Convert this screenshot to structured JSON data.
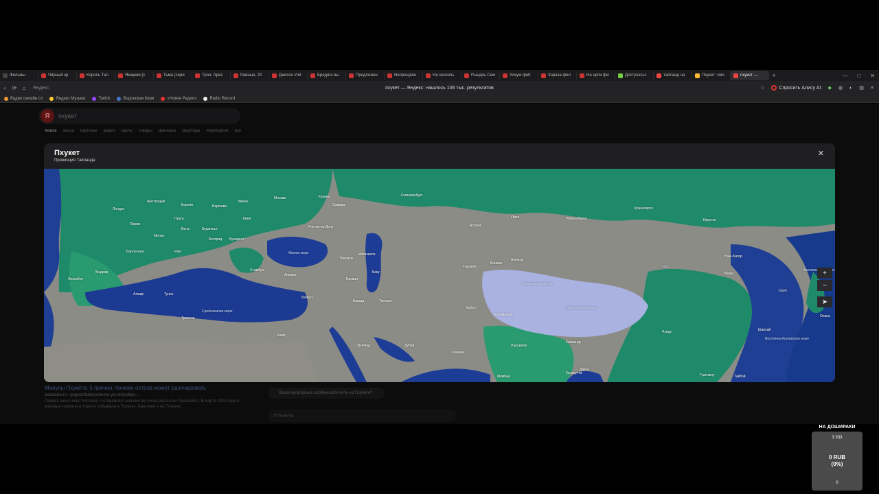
{
  "browser": {
    "tabs": [
      {
        "label": "Фильмы",
        "color": "#444"
      },
      {
        "label": "Чёрный кр",
        "color": "#c33"
      },
      {
        "label": "Король Тал",
        "color": "#c33"
      },
      {
        "label": "Ямщики (с",
        "color": "#c33"
      },
      {
        "label": "Тьма (сери",
        "color": "#c33"
      },
      {
        "label": "Трон: Арес",
        "color": "#c33"
      },
      {
        "label": "Равные, 20",
        "color": "#c33"
      },
      {
        "label": "Джесси Уэй",
        "color": "#c33"
      },
      {
        "label": "Бродяга вы",
        "color": "#c33"
      },
      {
        "label": "Предложен",
        "color": "#c33"
      },
      {
        "label": "Непрощённ",
        "color": "#c33"
      },
      {
        "label": "На несколь",
        "color": "#c33"
      },
      {
        "label": "Рыцарь Сем",
        "color": "#c33"
      },
      {
        "label": "Хокум фиб",
        "color": "#c33"
      },
      {
        "label": "Зараза фил",
        "color": "#c33"
      },
      {
        "label": "На цепи фи",
        "color": "#c33"
      },
      {
        "label": "Достучатьс",
        "color": "#7c4"
      },
      {
        "label": "тайланд на",
        "color": "#e44"
      },
      {
        "label": "Пхукет: смо",
        "color": "#fb3"
      },
      {
        "label": "пхукет —",
        "color": "#e44",
        "active": true
      }
    ],
    "new_tab": "+",
    "win_controls": [
      "—",
      "□",
      "✕"
    ],
    "address": {
      "domain": "Яндекс",
      "title": "пхукет — Яндекс: нашлось 106 тыс. результатов",
      "alice_label": "Спросить Алису AI"
    },
    "bookmarks": [
      {
        "label": "Радио онлайн сл",
        "color": "#e93"
      },
      {
        "label": "Яндекс Музыка",
        "color": "#fc3"
      },
      {
        "label": "Twitch",
        "color": "#94f"
      },
      {
        "label": "Водонская Кири",
        "color": "#47c"
      },
      {
        "label": "«Новое Радио»",
        "color": "#e33"
      },
      {
        "label": "Radio Record",
        "color": "#eee"
      }
    ]
  },
  "page": {
    "search_query": "пхукет",
    "logo": "Я",
    "tabs": [
      "поиск",
      "алиса",
      "картинки",
      "видео",
      "карты",
      "товары",
      "финансы",
      "квартиры",
      "переводчик",
      "все"
    ],
    "result": {
      "title": "Минусы Пхукета: 5 причин, почему остров может разочаровать",
      "url": "aviasales.ru › psgc/article/pochemu-ya-ne-lyublyu-...",
      "snippet": "Привет, меня зовут Наташа, я отправляю знакомству email-рассылки Авиасейлс. В марте 2024 года я впервые поехала в Азию и побывала в Пхукете, Бангкоке и на Пхукете."
    },
    "ai_question": "Какие культурные особенности есть на Пхукете?",
    "ai_input_placeholder": "Уточнить"
  },
  "modal": {
    "title": "Пхукет",
    "subtitle": "Провинция Таиланда",
    "close": "✕",
    "map_labels": {
      "london": "Лондон",
      "amsterdam": "Амстердам",
      "berlin": "Берлин",
      "warsaw": "Варшава",
      "minsk": "Минск",
      "moscow": "Москва",
      "kazan": "Казань",
      "samara": "Самара",
      "ekaterinburg": "Екатеринбург",
      "paris": "Париж",
      "prague": "Прага",
      "kyiv": "Киев",
      "vienna": "Вена",
      "budapest": "Будапешт",
      "milan": "Милан",
      "belgrade": "Белград",
      "bucharest": "Бухарест",
      "rostov": "Ростов-на-Дону",
      "rome": "Рим",
      "barcelona": "Барселона",
      "madrid": "Мадрид",
      "lisbon": "Лиссабон",
      "istanbul": "Стамбул",
      "ankara": "Анкара",
      "algiers": "Алжир",
      "tunis": "Тунис",
      "tripoli": "Триполи",
      "beirut": "Бейрут",
      "baghdad": "Багдад",
      "cairo": "Каир",
      "riyadh": "Эр-Рияд",
      "dubai": "Дубай",
      "tehran": "Тегеран",
      "baku": "Баку",
      "tbilisi": "Тбилиси",
      "yerevan": "Ереван",
      "makhachkala": "Махачкала",
      "tashkent": "Ташкент",
      "almaty": "Алматы",
      "bishkek": "Бишкек",
      "astana": "Астана",
      "novosibirsk": "Новосибирск",
      "omsk": "Омск",
      "krasnoyarsk": "Красноярск",
      "irkutsk": "Иркутск",
      "ulanbator": "Улан-Батор",
      "kabul": "Кабул",
      "islamabad": "Исламабад",
      "karachi": "Карачи",
      "delhi": "Нью-Дели",
      "mumbai": "Мумбаи",
      "kathmandu": "Катманду",
      "dhaka": "Дакка",
      "kolkata": "Калькутта",
      "beijing": "Пекин",
      "shanghai": "Шанхай",
      "seoul": "Сеул",
      "osaka": "Осака",
      "guangzhou": "Гуанчжоу",
      "taipei": "Тайбэй",
      "chengdu": "Чэнду",
      "gobi": "Гоби",
      "tibet": "Тибетское нагорье",
      "tarim": "Таримская впадина",
      "black_sea": "Чёрное море",
      "mediterranean": "Средиземное море",
      "japan_sea": "Японское море/Восточное море",
      "east_china_sea": "Восточно-Китайское море"
    },
    "controls": {
      "zoom_in": "+",
      "zoom_out": "−",
      "locate": "➤"
    }
  },
  "donation": {
    "title": "НА ДОШИРАКИ",
    "goal": "3 333",
    "amount": "0 RUB",
    "percent": "(0%)",
    "min": "0"
  }
}
